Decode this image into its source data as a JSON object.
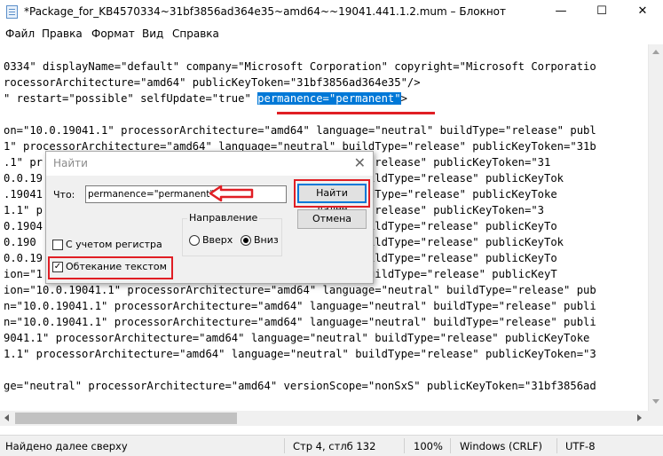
{
  "window": {
    "title": "*Package_for_KB4570334~31bf3856ad364e35~amd64~~19041.441.1.2.mum – Блокнот",
    "minimize": "—",
    "maximize": "☐",
    "close": "✕"
  },
  "menu": [
    "Файл",
    "Правка",
    "Формат",
    "Вид",
    "Справка"
  ],
  "editor": {
    "line1": "0334\" displayName=\"default\" company=\"Microsoft Corporation\" copyright=\"Microsoft Corporatio",
    "line2": "rocessorArchitecture=\"amd64\" publicKeyToken=\"31bf3856ad364e35\"/>",
    "line3_pre": "\" restart=\"possible\" selfUpdate=\"true\" ",
    "line3_sel": "permanence=\"permanent\"",
    "line3_post": ">",
    "body_lines": [
      "on=\"10.0.19041.1\" processorArchitecture=\"amd64\" language=\"neutral\" buildType=\"release\" publ",
      "1\" processorArchitecture=\"amd64\" language=\"neutral\" buildType=\"release\" publicKeyToken=\"31b",
      ".1\" pr                                        buildType=\"release\" publicKeyToken=\"31",
      "0.0.19                                        eutral\" buildType=\"release\" publicKeyTok",
      ".19041                                        tral\" buildType=\"release\" publicKeyToke",
      "1.1\" p                                        buildType=\"release\" publicKeyToken=\"3",
      "0.1904                                        eutral\" buildType=\"release\" publicKeyTo",
      "0.190                                         eutral\" buildType=\"release\" publicKeyTok",
      "0.0.19                                        eutral\" buildType=\"release\" publicKeyTo",
      "ion=\"1                                        neutral\" buildType=\"release\" publicKeyT",
      "ion=\"10.0.19041.1\" processorArchitecture=\"amd64\" language=\"neutral\" buildType=\"release\" pub",
      "n=\"10.0.19041.1\" processorArchitecture=\"amd64\" language=\"neutral\" buildType=\"release\" publi",
      "n=\"10.0.19041.1\" processorArchitecture=\"amd64\" language=\"neutral\" buildType=\"release\" publi",
      "9041.1\" processorArchitecture=\"amd64\" language=\"neutral\" buildType=\"release\" publicKeyToke",
      "1.1\" processorArchitecture=\"amd64\" language=\"neutral\" buildType=\"release\" publicKeyToken=\"3",
      "",
      "ge=\"neutral\" processorArchitecture=\"amd64\" versionScope=\"nonSxS\" publicKeyToken=\"31bf3856ad"
    ]
  },
  "find_dialog": {
    "title": "Найти",
    "what_label": "Что:",
    "what_value": "permanence=\"permanent\"",
    "find_next": "Найти далее",
    "cancel": "Отмена",
    "direction_title": "Направление",
    "up": "Вверх",
    "down": "Вниз",
    "match_case": "С учетом регистра",
    "wrap_around": "Обтекание текстом"
  },
  "status": {
    "message": "Найдено далее сверху",
    "position": "Стр 4, стлб 132",
    "zoom": "100%",
    "line_endings": "Windows (CRLF)",
    "encoding": "UTF-8"
  },
  "colors": {
    "selection": "#0078d7",
    "annotation": "#e01e24"
  }
}
